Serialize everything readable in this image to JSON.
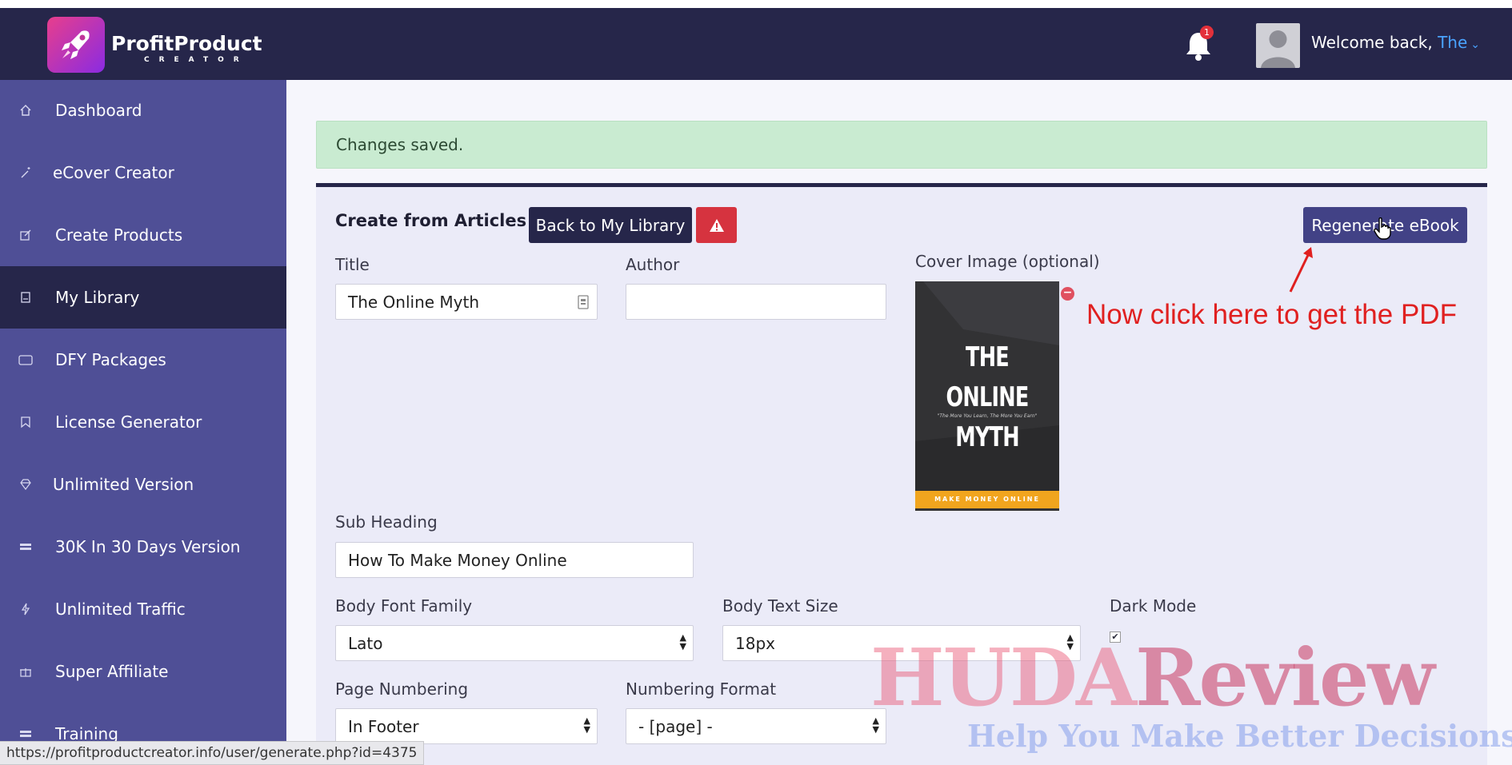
{
  "app": {
    "logo_title": "ProfitProduct",
    "logo_sub": "CREATOR",
    "notification_count": "1",
    "welcome_prefix": "Welcome back, ",
    "welcome_name": "The"
  },
  "sidebar": {
    "items": [
      {
        "label": "Dashboard",
        "icon": "home-icon"
      },
      {
        "label": "eCover Creator",
        "icon": "magic-wand-icon"
      },
      {
        "label": "Create Products",
        "icon": "edit-icon"
      },
      {
        "label": "My Library",
        "icon": "book-icon",
        "active": true
      },
      {
        "label": "DFY Packages",
        "icon": "folder-icon"
      },
      {
        "label": "License Generator",
        "icon": "bookmark-icon"
      },
      {
        "label": "Unlimited Version",
        "icon": "diamond-icon"
      },
      {
        "label": "30K In 30 Days Version",
        "icon": "server-icon"
      },
      {
        "label": "Unlimited Traffic",
        "icon": "bolt-icon"
      },
      {
        "label": "Super Affiliate",
        "icon": "gift-icon"
      },
      {
        "label": "Training",
        "icon": "list-icon"
      }
    ]
  },
  "alert": {
    "message": "Changes saved."
  },
  "form": {
    "heading": "Create from Articles",
    "back_button": "Back to My Library",
    "regenerate_button": "Regenerate eBook",
    "title_label": "Title",
    "title_value": "The Online Myth",
    "author_label": "Author",
    "author_value": "",
    "cover_label": "Cover Image (optional)",
    "subheading_label": "Sub Heading",
    "subheading_value": "How To Make Money Online",
    "body_font_label": "Body Font Family",
    "body_font_value": "Lato",
    "body_size_label": "Body Text Size",
    "body_size_value": "18px",
    "dark_mode_label": "Dark Mode",
    "dark_mode_checked": true,
    "page_numbering_label": "Page Numbering",
    "page_numbering_value": "In Footer",
    "numbering_format_label": "Numbering Format",
    "numbering_format_value": "- [page] -"
  },
  "cover": {
    "title": "THE ONLINE MYTH",
    "tagline": "\"The More You Learn, The More You Earn\"",
    "band": "MAKE MONEY ONLINE"
  },
  "annotation": {
    "text": "Now click here to get the PDF"
  },
  "watermark": {
    "main_a": "HUDA",
    "main_b": "Review",
    "sub": "Help You Make Better Decisions"
  },
  "statusbar": {
    "url": "https://profitproductcreator.info/user/generate.php?id=4375"
  },
  "colors": {
    "header": "#26264a",
    "sidebar": "#4f4f96",
    "alert_bg": "#c9ebd1",
    "danger": "#d6333f",
    "annotation": "#e02020"
  }
}
